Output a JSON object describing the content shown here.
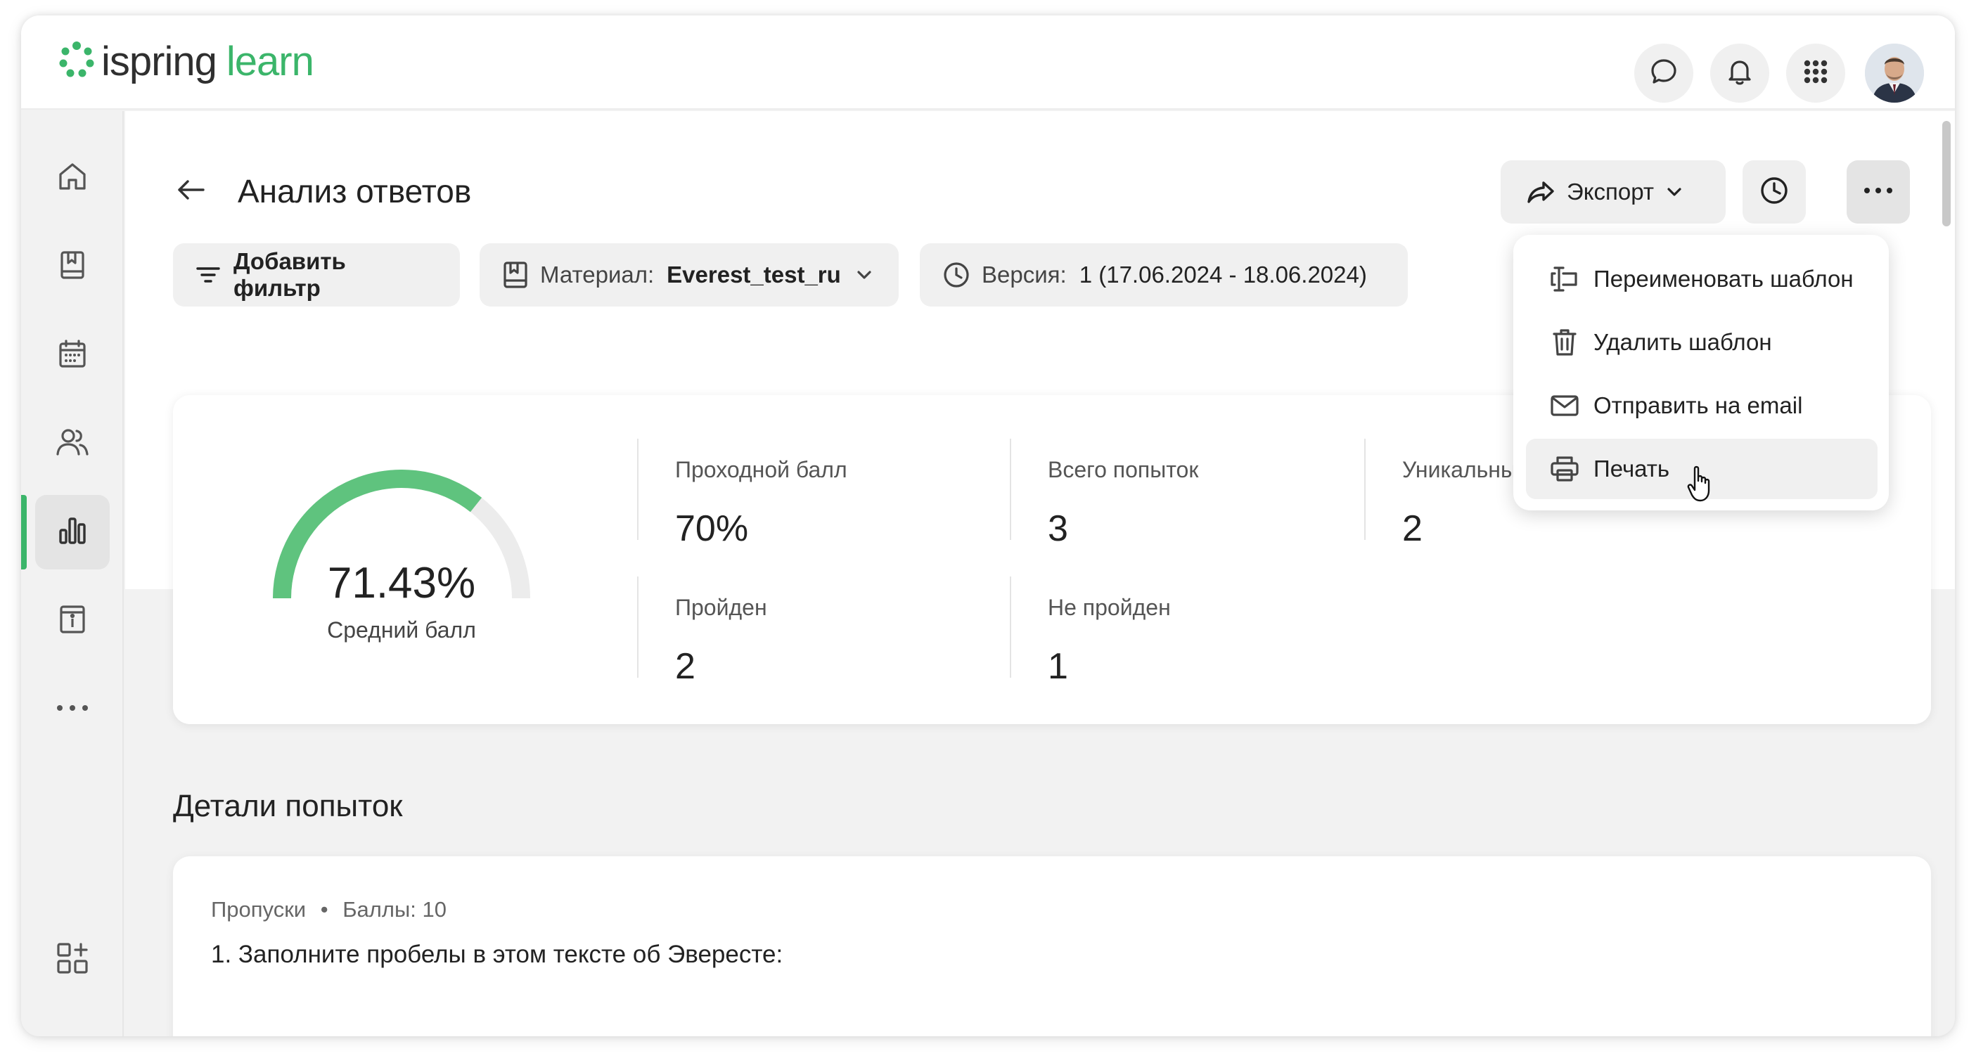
{
  "app": {
    "logo_ispring": "ispring",
    "logo_learn": "learn",
    "brand_color": "#3bb56a"
  },
  "header": {
    "icons": [
      "chat-icon",
      "bell-icon",
      "apps-grid-icon"
    ],
    "avatar": "user-avatar"
  },
  "sidebar": {
    "items": [
      {
        "name": "home",
        "icon": "home-icon",
        "active": false
      },
      {
        "name": "courses",
        "icon": "book-icon",
        "active": false
      },
      {
        "name": "calendar",
        "icon": "calendar-icon",
        "active": false
      },
      {
        "name": "users",
        "icon": "users-icon",
        "active": false
      },
      {
        "name": "reports",
        "icon": "bar-chart-icon",
        "active": true
      },
      {
        "name": "info",
        "icon": "info-icon",
        "active": false
      },
      {
        "name": "more",
        "icon": "more-horizontal-icon",
        "active": false
      },
      {
        "name": "add-widget",
        "icon": "add-widget-icon",
        "active": false
      }
    ]
  },
  "page": {
    "title": "Анализ ответов"
  },
  "toolbar": {
    "export_label": "Экспорт"
  },
  "filters": {
    "add_filter": "Добавить фильтр",
    "material_label": "Материал:",
    "material_value": "Everest_test_ru",
    "version_label": "Версия:",
    "version_value": "1 (17.06.2024 - 18.06.2024)"
  },
  "stats": {
    "average_score": 71.43,
    "average_score_text": "71.43%",
    "average_label": "Средний балл",
    "items": [
      {
        "label": "Проходной балл",
        "value": "70%"
      },
      {
        "label": "Всего попыток",
        "value": "3"
      },
      {
        "label": "Уникальны",
        "value": "2"
      },
      {
        "label": "Пройден",
        "value": "2"
      },
      {
        "label": "Не пройден",
        "value": "1"
      }
    ]
  },
  "details": {
    "title": "Детали попыток",
    "question_type": "Пропуски",
    "separator": "•",
    "points": "Баллы: 10",
    "question_text": "1. Заполните пробелы в этом тексте об Эвересте:"
  },
  "menu": {
    "items": [
      {
        "label": "Переименовать шаблон",
        "icon": "rename-icon"
      },
      {
        "label": "Удалить шаблон",
        "icon": "trash-icon"
      },
      {
        "label": "Отправить на email",
        "icon": "mail-icon"
      },
      {
        "label": "Печать",
        "icon": "printer-icon",
        "hovered": true
      }
    ]
  }
}
